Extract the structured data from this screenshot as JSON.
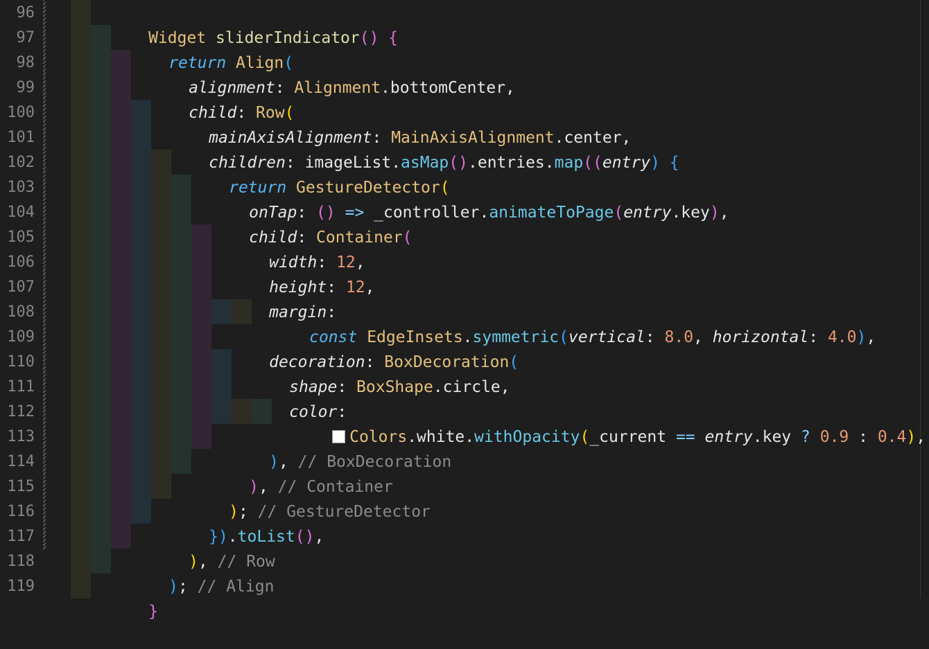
{
  "colors": {
    "background": "#1e1e1e",
    "line_number": "#858585",
    "class": "#e5c07b",
    "keyword": "#56b6f5",
    "number": "#e79773",
    "comment": "#8b8b8b",
    "bracket_gold": "#ffd700",
    "bracket_purple": "#da70d6",
    "bracket_blue": "#3aa6f8",
    "swatch_white": "#ffffff"
  },
  "line_numbers": [
    "96",
    "97",
    "98",
    "99",
    "100",
    "101",
    "102",
    "103",
    "104",
    "105",
    "106",
    "107",
    "108",
    "109",
    "110",
    "111",
    "112",
    "113",
    "114",
    "115",
    "116",
    "117",
    "118",
    "119"
  ],
  "code": {
    "l96": {
      "a": "Widget",
      "b": " sliderIndicator",
      "c": "()",
      "d": " {"
    },
    "l97": {
      "a": "return",
      "b": " Align",
      "c": "("
    },
    "l98": {
      "a": "alignment",
      "b": ": ",
      "c": "Alignment",
      "d": ".bottomCenter,"
    },
    "l99": {
      "a": "child",
      "b": ": ",
      "c": "Row",
      "d": "("
    },
    "l100": {
      "a": "mainAxisAlignment",
      "b": ": ",
      "c": "MainAxisAlignment",
      "d": ".center,"
    },
    "l101": {
      "a": "children",
      "b": ": imageList.",
      "c": "asMap",
      "d": "()",
      "e": ".entries.",
      "f": "map",
      "g": "((",
      "h": "entry",
      "i": ")",
      "j": " {"
    },
    "l102": {
      "a": "return",
      "b": " GestureDetector",
      "c": "("
    },
    "l103": {
      "a": "onTap",
      "b": ": ",
      "c": "()",
      "d": " => ",
      "e": "_controller.",
      "f": "animateToPage",
      "g": "(",
      "h": "entry",
      "i": ".key",
      "j": ")",
      "k": ","
    },
    "l104": {
      "a": "child",
      "b": ": ",
      "c": "Container",
      "d": "("
    },
    "l105": {
      "a": "width",
      "b": ": ",
      "c": "12",
      "d": ","
    },
    "l106": {
      "a": "height",
      "b": ": ",
      "c": "12",
      "d": ","
    },
    "l107": {
      "a": "margin",
      "b": ":"
    },
    "l108": {
      "a": "const",
      "b": " EdgeInsets",
      "c": ".",
      "d": "symmetric",
      "e": "(",
      "f": "vertical",
      "g": ": ",
      "h": "8.0",
      "i": ", ",
      "j": "horizontal",
      "k": ": ",
      "l": "4.0",
      "m": ")",
      "n": ","
    },
    "l109": {
      "a": "decoration",
      "b": ": ",
      "c": "BoxDecoration",
      "d": "("
    },
    "l110": {
      "a": "shape",
      "b": ": ",
      "c": "BoxShape",
      "d": ".circle,"
    },
    "l111": {
      "a": "color",
      "b": ":"
    },
    "l112": {
      "a": "Colors",
      "b": ".white.",
      "c": "withOpacity",
      "d": "(",
      "e": "_current ",
      "f": "==",
      "g": " ",
      "h": "entry",
      "i": ".key ",
      "j": "?",
      "k": " ",
      "l": "0.9",
      "m": " : ",
      "n": "0.4",
      "o": ")",
      "p": ","
    },
    "l113": {
      "a": ")",
      "b": ", ",
      "c": "// BoxDecoration"
    },
    "l114": {
      "a": ")",
      "b": ", ",
      "c": "// Container"
    },
    "l115": {
      "a": ")",
      "b": "; ",
      "c": "// GestureDetector"
    },
    "l116": {
      "a": "})",
      "b": ".",
      "c": "toList",
      "d": "()",
      "e": ","
    },
    "l117": {
      "a": ")",
      "b": ", ",
      "c": "// Row"
    },
    "l118": {
      "a": ")",
      "b": "; ",
      "c": "// Align"
    },
    "l119": {
      "a": "}"
    }
  }
}
